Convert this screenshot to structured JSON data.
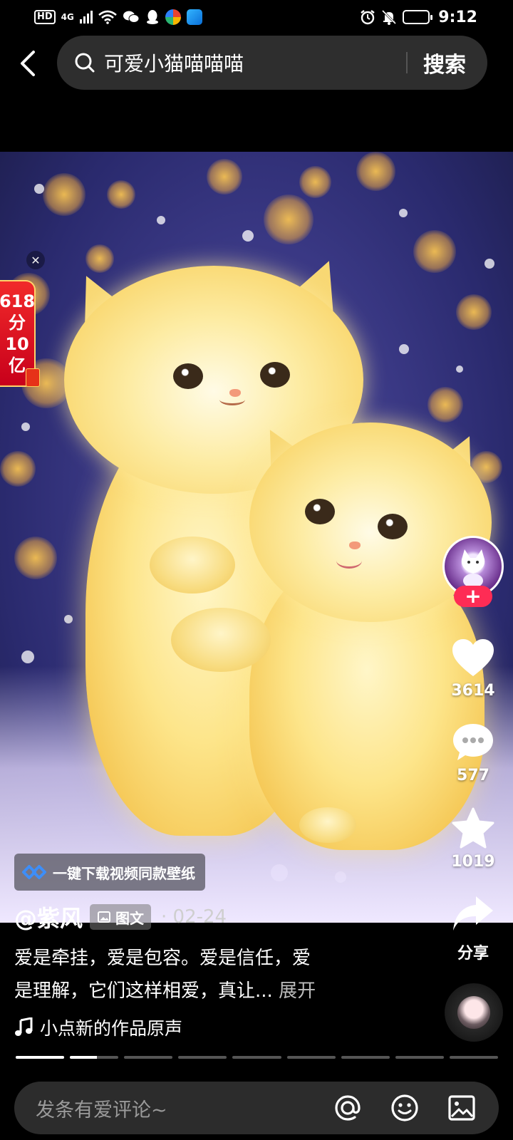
{
  "status_bar": {
    "hd": "HD",
    "net": "4G",
    "time": "9:12",
    "battery_level": 0.85
  },
  "search": {
    "query": "可爱小猫喵喵喵",
    "button": "搜索"
  },
  "promo": {
    "line1": "618",
    "line2": "分",
    "line3": "10",
    "line4": "亿"
  },
  "rail": {
    "likes": "3614",
    "comments": "577",
    "favorites": "1019",
    "share": "分享",
    "follow_symbol": "+"
  },
  "post": {
    "download_banner": "一键下载视频同款壁纸",
    "author": "@紫风",
    "tag": "图文",
    "date": "· 02-24",
    "desc_line1": "爱是牵挂，爱是包容。爱是信任，爱",
    "desc_line2": "是理解，它们这样相爱，真让...",
    "more": "展开",
    "music": "小点新的作品原声"
  },
  "progress": {
    "segments": 9,
    "current_segment": 2,
    "current_fill": 0.55
  },
  "comment_bar": {
    "placeholder": "发条有爱评论~"
  },
  "colors": {
    "accent": "#fe2c55",
    "background": "#000000",
    "input_bg": "#2c2c2c"
  },
  "icons": [
    "back-arrow-icon",
    "search-icon",
    "heart-icon",
    "comment-icon",
    "star-icon",
    "share-icon",
    "music-note-icon",
    "at-icon",
    "emoji-icon",
    "image-icon",
    "close-icon"
  ]
}
